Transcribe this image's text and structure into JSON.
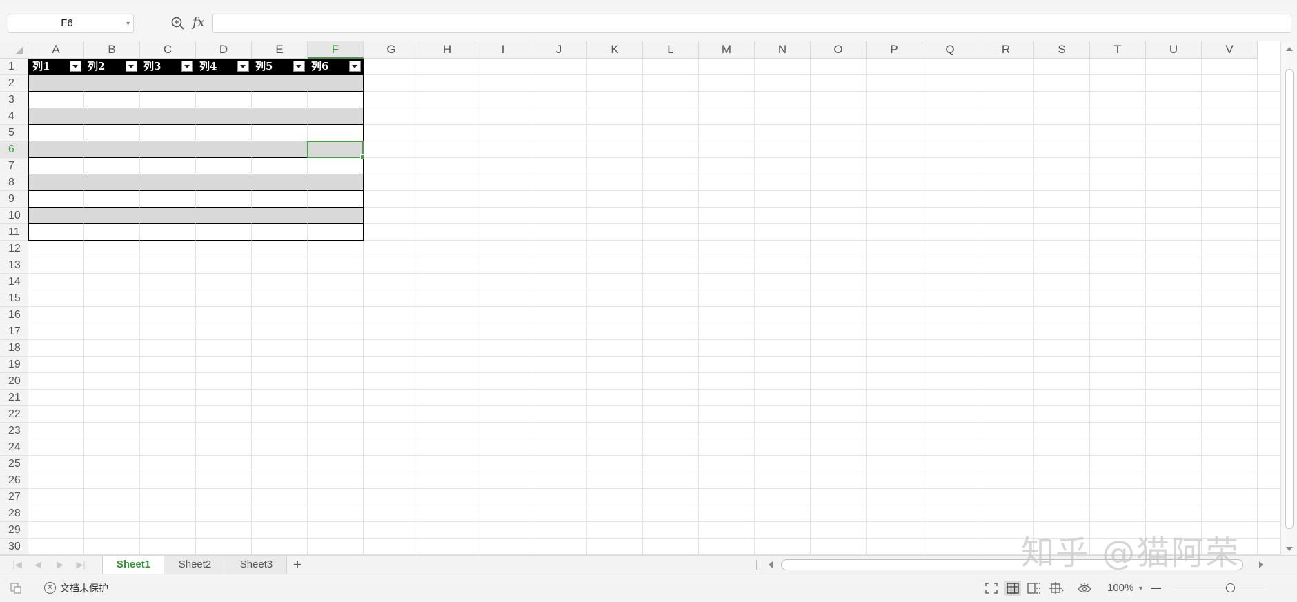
{
  "formula_bar": {
    "cell_reference": "F6",
    "fx_label": "fx",
    "formula_value": ""
  },
  "grid": {
    "columns": [
      "A",
      "B",
      "C",
      "D",
      "E",
      "F",
      "G",
      "H",
      "I",
      "J",
      "K",
      "L",
      "M",
      "N",
      "O",
      "P",
      "Q",
      "R",
      "S",
      "T",
      "U",
      "V"
    ],
    "rows": [
      "1",
      "2",
      "3",
      "4",
      "5",
      "6",
      "7",
      "8",
      "9",
      "10",
      "11",
      "12",
      "13",
      "14",
      "15",
      "16",
      "17",
      "18",
      "19",
      "20",
      "21",
      "22",
      "23",
      "24",
      "25",
      "26",
      "27",
      "28",
      "29",
      "30"
    ],
    "active_column": "F",
    "active_row": "6",
    "table_headers": [
      "列1",
      "列2",
      "列3",
      "列4",
      "列5",
      "列6"
    ]
  },
  "sheet_tabs": {
    "tabs": [
      "Sheet1",
      "Sheet2",
      "Sheet3"
    ],
    "active": "Sheet1",
    "add_label": "+"
  },
  "status_bar": {
    "protection_text": "文档未保护",
    "zoom_level": "100%"
  },
  "watermark": {
    "text": "知乎 @猫阿荣"
  },
  "colors": {
    "accent_green": "#3a9a3a",
    "table_header_bg": "#000000",
    "band_row_bg": "#d9d9d9"
  }
}
